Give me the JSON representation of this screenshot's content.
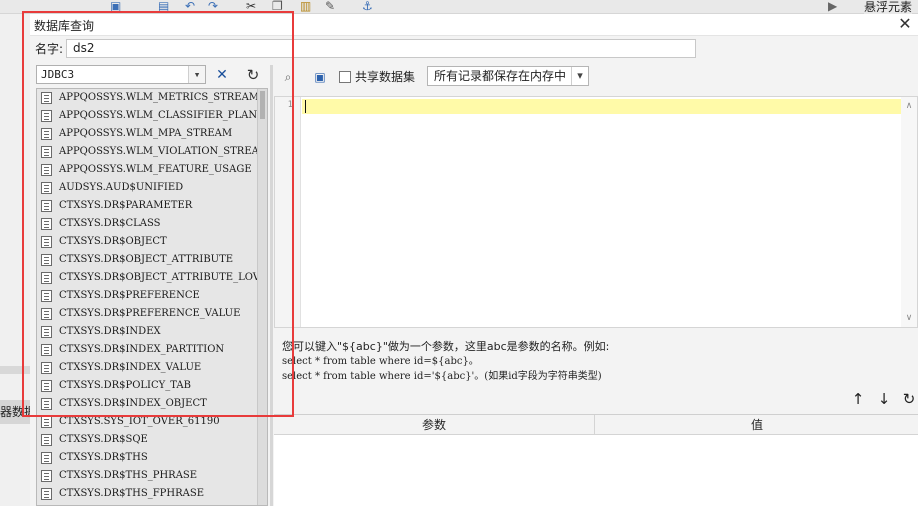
{
  "background": {
    "right_title": "悬浮元素",
    "left_tab": "器数据"
  },
  "dialog": {
    "title": "数据库查询",
    "name_label": "名字:",
    "name_value": "ds2"
  },
  "left_panel": {
    "connection": "JDBC3",
    "tables": [
      "APPQOSSYS.WLM_METRICS_STREAM",
      "APPQOSSYS.WLM_CLASSIFIER_PLAN",
      "APPQOSSYS.WLM_MPA_STREAM",
      "APPQOSSYS.WLM_VIOLATION_STREAM",
      "APPQOSSYS.WLM_FEATURE_USAGE",
      "AUDSYS.AUD$UNIFIED",
      "CTXSYS.DR$PARAMETER",
      "CTXSYS.DR$CLASS",
      "CTXSYS.DR$OBJECT",
      "CTXSYS.DR$OBJECT_ATTRIBUTE",
      "CTXSYS.DR$OBJECT_ATTRIBUTE_LOV",
      "CTXSYS.DR$PREFERENCE",
      "CTXSYS.DR$PREFERENCE_VALUE",
      "CTXSYS.DR$INDEX",
      "CTXSYS.DR$INDEX_PARTITION",
      "CTXSYS.DR$INDEX_VALUE",
      "CTXSYS.DR$POLICY_TAB",
      "CTXSYS.DR$INDEX_OBJECT",
      "CTXSYS.SYS_IOT_OVER_61190",
      "CTXSYS.DR$SQE",
      "CTXSYS.DR$THS",
      "CTXSYS.DR$THS_PHRASE",
      "CTXSYS.DR$THS_FPHRASE"
    ]
  },
  "right_panel": {
    "share_label": "共享数据集",
    "memory_option": "所有记录都保存在内存中",
    "editor": {
      "line_number": "1",
      "content": ""
    },
    "help": {
      "line1": "您可以键入\"${abc}\"做为一个参数，这里abc是参数的名称。例如:",
      "line2": "select * from table where id=${abc}。",
      "line3": "select * from table where id='${abc}'。(如果id字段为字符串类型)"
    },
    "params": {
      "header_name": "参数",
      "header_value": "值"
    }
  },
  "colors": {
    "highlight_frame": "#e83b3b",
    "current_line": "#fffaa8"
  }
}
